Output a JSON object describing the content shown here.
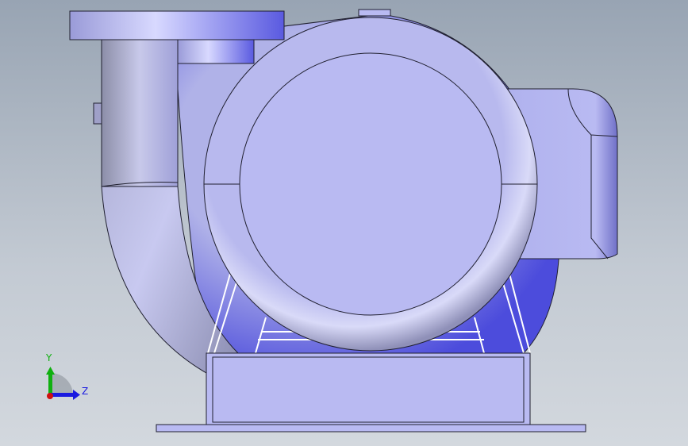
{
  "viewport": {
    "model": "pump-assembly",
    "view_orientation": "front",
    "colors": {
      "model_fill": "#b9baf2",
      "model_dark": "#5858e0",
      "edge": "#202030",
      "background_top": "#98a4b3",
      "background_bottom": "#d3d8de"
    }
  },
  "triad": {
    "y_label": "Y",
    "z_label": "Z",
    "colors": {
      "y": "#10b010",
      "z": "#1a1ae0",
      "x": "#d01010"
    }
  }
}
